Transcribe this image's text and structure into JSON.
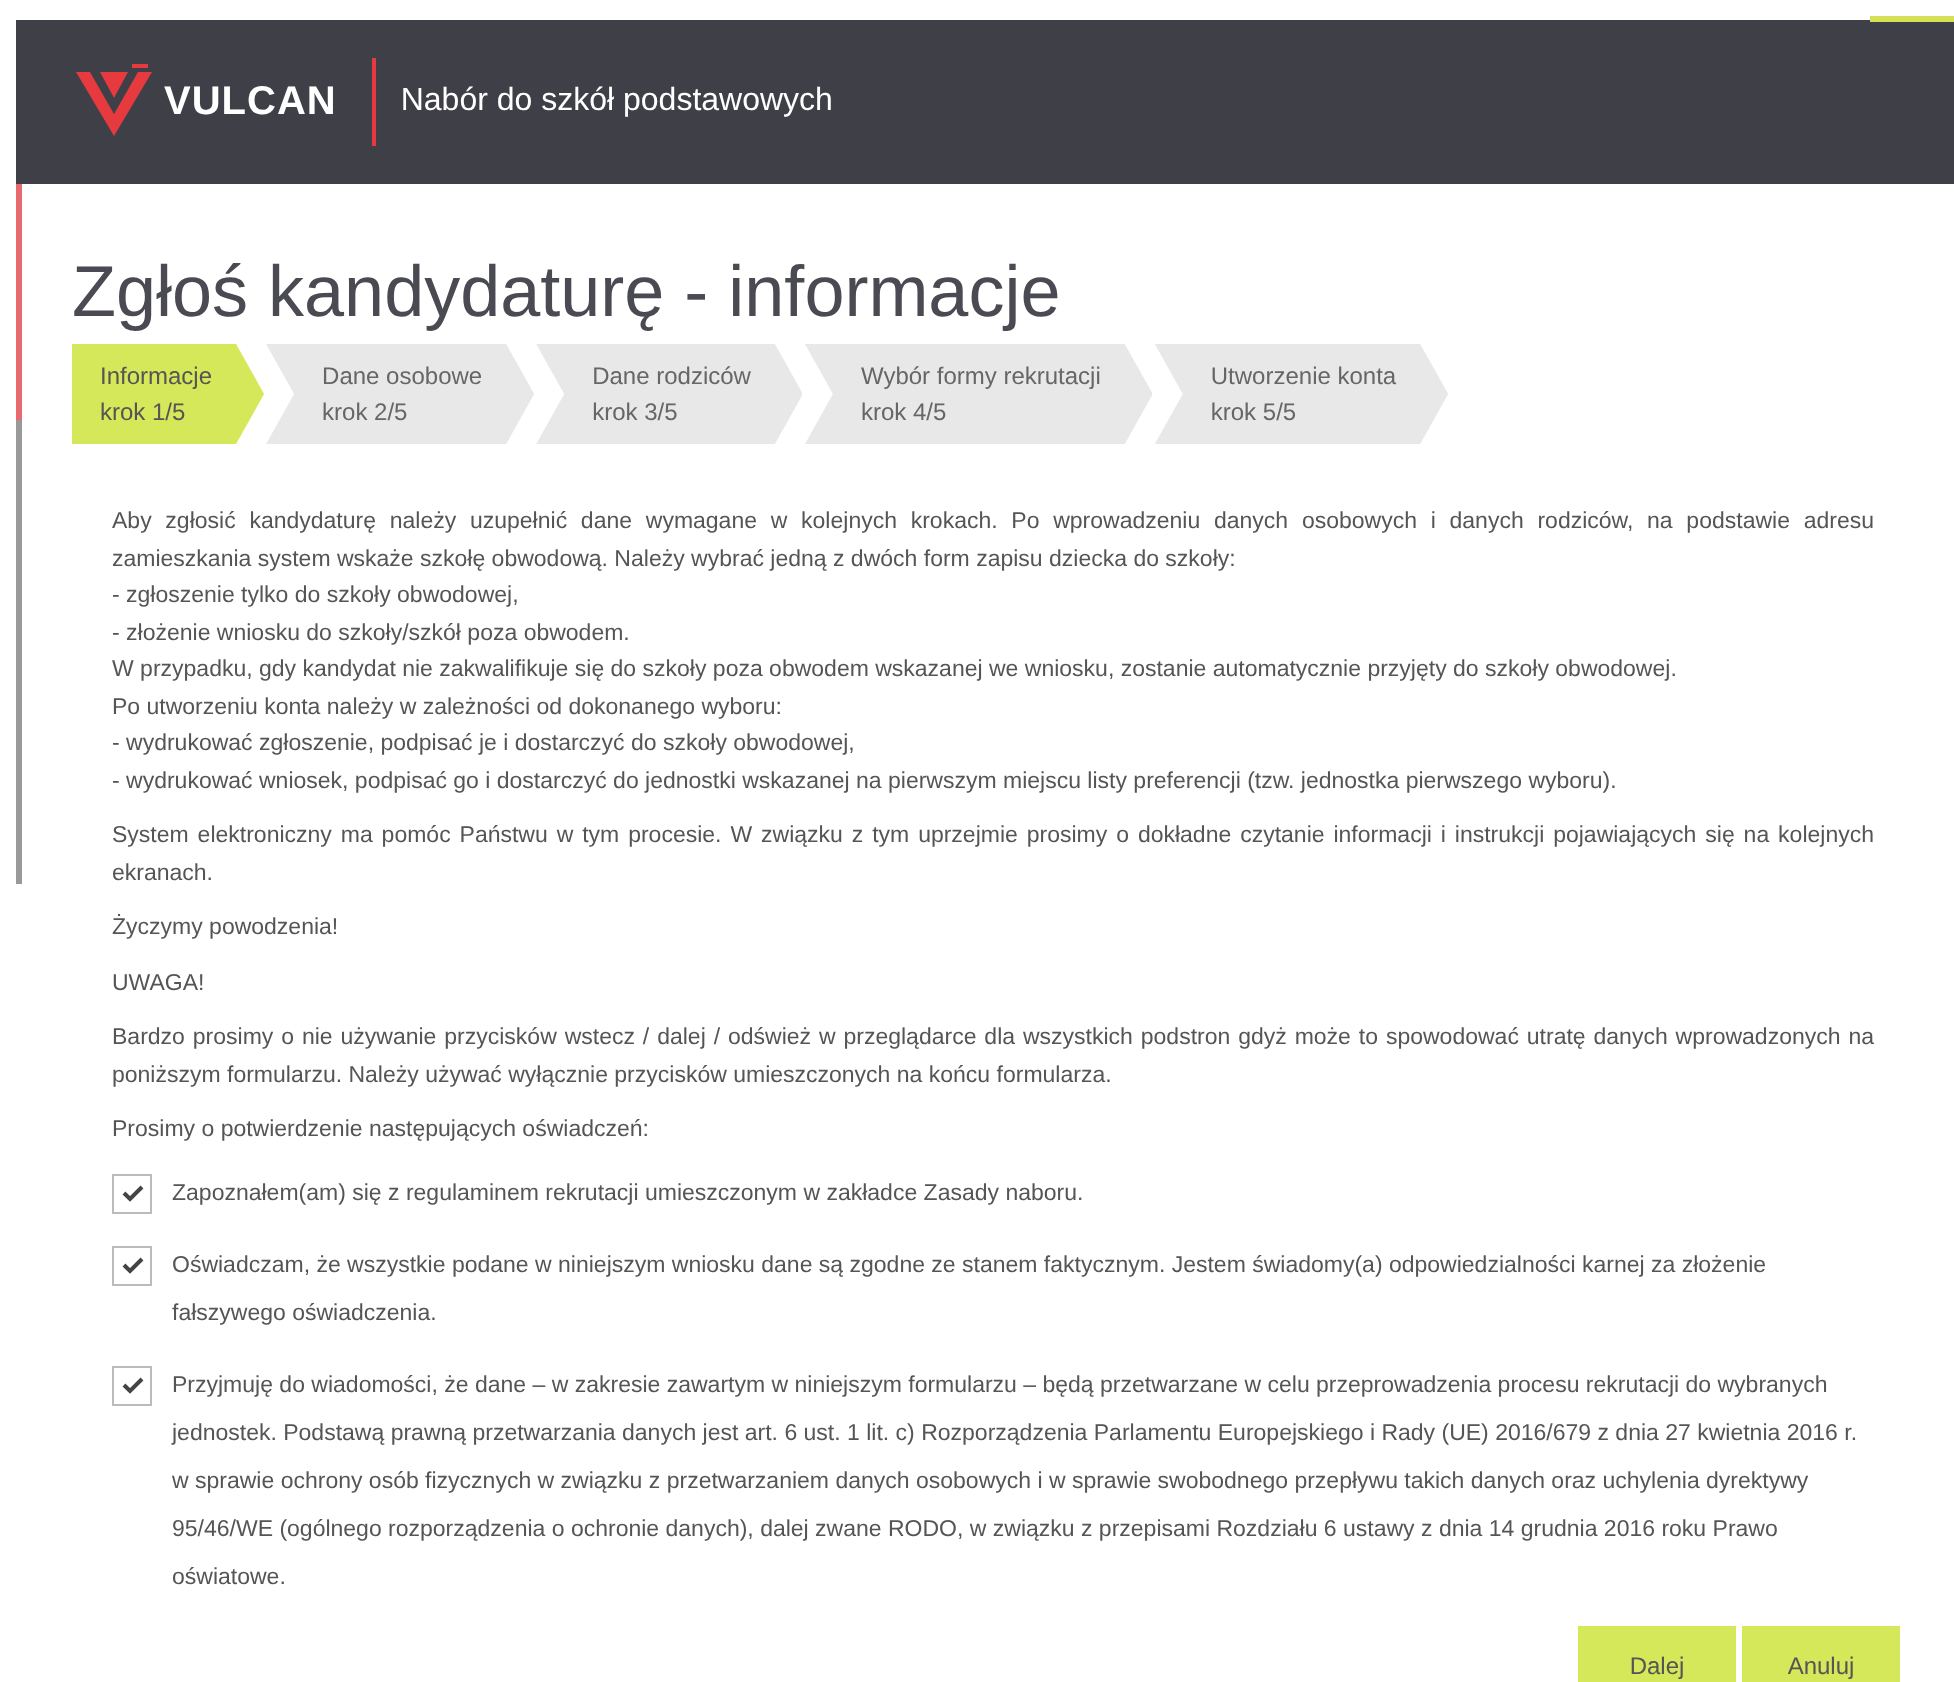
{
  "header": {
    "logo_text": "VULCAN",
    "app_title": "Nabór do szkół podstawowych"
  },
  "title": "Zgłoś kandydaturę - informacje",
  "steps": [
    {
      "label": "Informacje",
      "sub": "krok 1/5",
      "selected": true
    },
    {
      "label": "Dane osobowe",
      "sub": "krok 2/5",
      "selected": false
    },
    {
      "label": "Dane rodziców",
      "sub": "krok 3/5",
      "selected": false
    },
    {
      "label": "Wybór formy rekrutacji",
      "sub": "krok 4/5",
      "selected": false
    },
    {
      "label": "Utworzenie konta",
      "sub": "krok 5/5",
      "selected": false
    }
  ],
  "intro_lines": [
    "Aby zgłosić kandydaturę należy uzupełnić dane wymagane w kolejnych krokach. Po wprowadzeniu danych osobowych i danych rodziców, na podstawie adresu zamieszkania system wskaże szkołę obwodową. Należy wybrać jedną z dwóch form zapisu dziecka do szkoły:",
    "- zgłoszenie tylko do szkoły obwodowej,",
    "- złożenie wniosku do szkoły/szkół poza obwodem.",
    "W przypadku, gdy kandydat nie zakwalifikuje się do szkoły poza obwodem wskazanej we wniosku, zostanie automatycznie przyjęty do szkoły obwodowej.",
    "Po utworzeniu konta należy w zależności od dokonanego wyboru:",
    "- wydrukować zgłoszenie, podpisać je i dostarczyć do szkoły obwodowej,",
    "- wydrukować wniosek, podpisać go i dostarczyć do jednostki wskazanej na pierwszym miejscu listy preferencji (tzw. jednostka pierwszego wyboru)."
  ],
  "paragraphs": [
    "System elektroniczny ma pomóc Państwu w tym procesie. W związku z tym uprzejmie prosimy o dokładne czytanie informacji i instrukcji pojawiających się na kolejnych ekranach.",
    "Życzymy powodzenia!",
    "UWAGA!",
    "Bardzo prosimy o nie używanie przycisków wstecz / dalej / odśwież w przeglądarce dla wszystkich podstron gdyż może to spowodować utratę danych wprowadzonych na poniższym formularzu. Należy używać wyłącznie przycisków umieszczonych na końcu formularza.",
    "Prosimy o potwierdzenie następujących oświadczeń:"
  ],
  "declarations": [
    {
      "text": "Zapoznałem(am) się z regulaminem rekrutacji umieszczonym w zakładce Zasady naboru.",
      "checked": true
    },
    {
      "text": "Oświadczam, że wszystkie podane w niniejszym wniosku dane są zgodne ze stanem faktycznym. Jestem świadomy(a) odpowiedzialności karnej za złożenie fałszywego oświadczenia.",
      "checked": true
    },
    {
      "text": "Przyjmuję do wiadomości, że dane – w zakresie zawartym w niniejszym formularzu – będą przetwarzane w celu przeprowadzenia procesu rekrutacji do wybranych jednostek. Podstawą prawną przetwarzania danych jest art. 6 ust. 1 lit. c) Rozporządzenia Parlamentu Europejskiego i Rady (UE) 2016/679 z dnia 27 kwietnia 2016 r. w sprawie ochrony osób fizycznych w związku z przetwarzaniem danych osobowych i w sprawie swobodnego przepływu takich danych oraz uchylenia dyrektywy 95/46/WE (ogólnego rozporządzenia o ochronie danych), dalej zwane RODO, w związku z przepisami Rozdziału 6 ustawy z dnia 14 grudnia 2016 roku Prawo oświatowe.",
      "checked": true
    }
  ],
  "buttons": [
    "Dalej",
    "Anuluj"
  ]
}
